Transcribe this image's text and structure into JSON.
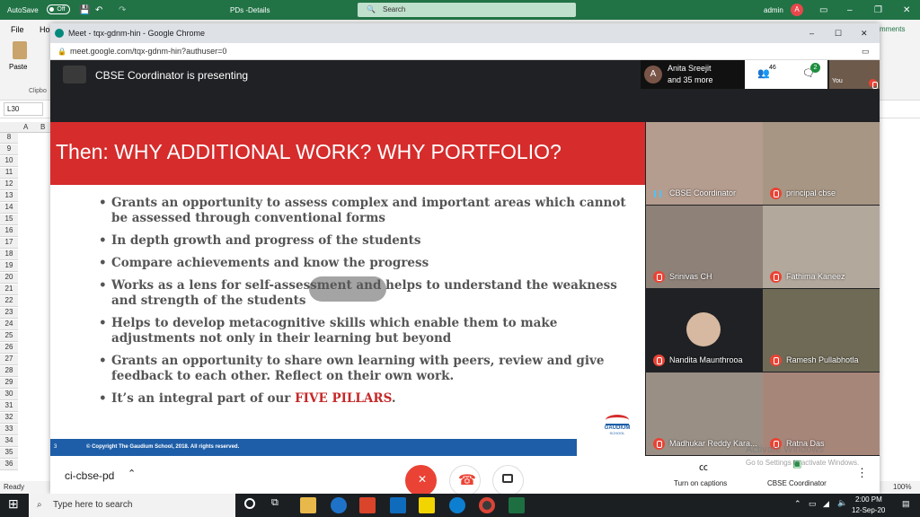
{
  "excel": {
    "autosave": "AutoSave",
    "autosave_state": "Off",
    "doc_title": "PDs -Details",
    "search": "Search",
    "user": "admin",
    "avatar": "A",
    "file_tab": "File",
    "home_tab": "Ho",
    "paste": "Paste",
    "clipboard": "Clipbo",
    "comments": "mments",
    "namebox": "L30",
    "cols": [
      "A",
      "B"
    ],
    "rows": [
      "8",
      "9",
      "10",
      "11",
      "12",
      "13",
      "14",
      "15",
      "16",
      "17",
      "18",
      "19",
      "20",
      "21",
      "22",
      "23",
      "24",
      "25",
      "26",
      "27",
      "28",
      "29",
      "30",
      "31",
      "32",
      "33",
      "34",
      "35",
      "36"
    ],
    "ready": "Ready",
    "zoom": "100%"
  },
  "chrome": {
    "tab_title": "Meet - tqx-gdnm-hin - Google Chrome",
    "url": "meet.google.com/tqx-gdnm-hin?authuser=0"
  },
  "meet": {
    "presenting": "CBSE Coordinator is presenting",
    "participants_line1": "Anita Sreejit",
    "participants_line2": "and 35 more",
    "participant_avatar": "A",
    "people_count": "46",
    "chat_count": "2",
    "you_label": "You",
    "tiles": [
      {
        "name": "CBSE Coordinator"
      },
      {
        "name": "principal cbse"
      },
      {
        "name": "Srinivas CH"
      },
      {
        "name": "Fathima Kaneez"
      },
      {
        "name": "Nandita Maunthrooa"
      },
      {
        "name": "Ramesh Pullabhotla"
      },
      {
        "name": "Madhukar Reddy Kara..."
      },
      {
        "name": "Ratna Das"
      }
    ],
    "meeting_code": "ci-cbse-pd",
    "captions": "Turn on captions",
    "presenter_label": "CBSE Coordinator",
    "activate_1": "Activate Windows",
    "activate_2": "Go to Settings to activate Windows."
  },
  "slide": {
    "heading": "Then: WHY ADDITIONAL WORK? WHY PORTFOLIO?",
    "bullets": [
      "Grants an opportunity to assess complex and important areas which cannot be assessed through conventional forms",
      "In depth growth and progress of the students",
      "Compare achievements and know the progress",
      "Works as a lens for self-assessment and helps to understand the weakness and strength of the students",
      "Helps to develop metacognitive skills which enable them to make adjustments not only in their learning but beyond",
      "Grants an opportunity to share own learning with peers, review and give feedback to each other. Reflect on their own work."
    ],
    "last_prefix": "It’s an integral part of our ",
    "last_highlight": "FIVE PILLARS",
    "last_suffix": ".",
    "page_number": "3",
    "copyright": "© Copyright The Gaudium School, 2018. All rights reserved.",
    "logo_text": "GAUDIUM",
    "logo_sub": "SCHOOL"
  },
  "taskbar": {
    "search_placeholder": "Type here to search",
    "time": "2:00 PM",
    "date": "12-Sep-20"
  }
}
